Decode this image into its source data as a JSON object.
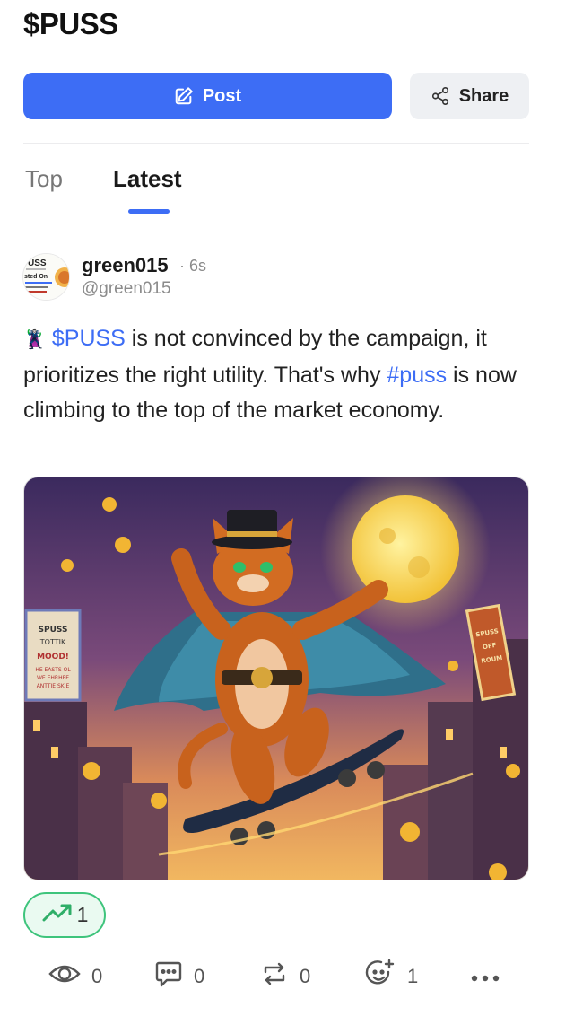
{
  "page": {
    "title": "$PUSS"
  },
  "actions": {
    "post_label": "Post",
    "share_label": "Share"
  },
  "tabs": [
    {
      "label": "Top"
    },
    {
      "label": "Latest"
    }
  ],
  "post": {
    "author": "green015",
    "time": "· 6s",
    "handle": "@green015",
    "text_emoji": "🦹",
    "text_cashtag": "$PUSS",
    "text_part1": " is not convinced by the campaign, it prioritizes the right utility. That's why ",
    "text_hashtag": "#puss",
    "text_part2": " is now climbing to the top of the market economy.",
    "avatar_lines": [
      "USS",
      "sted On"
    ],
    "image_sign_left": [
      "SPUSS",
      "TOTTIK",
      "MOOD!",
      "HE EASTS OL",
      "WE EHRHPE",
      "ANTTIE SKIE"
    ],
    "image_sign_right": [
      "SPUSS",
      "OFF",
      "ROUM"
    ],
    "trend_count": "1",
    "stats": {
      "views": "0",
      "comments": "0",
      "reposts": "0",
      "reactions": "1"
    }
  },
  "colors": {
    "accent": "#3d6df5",
    "trend": "#3ec47c"
  }
}
